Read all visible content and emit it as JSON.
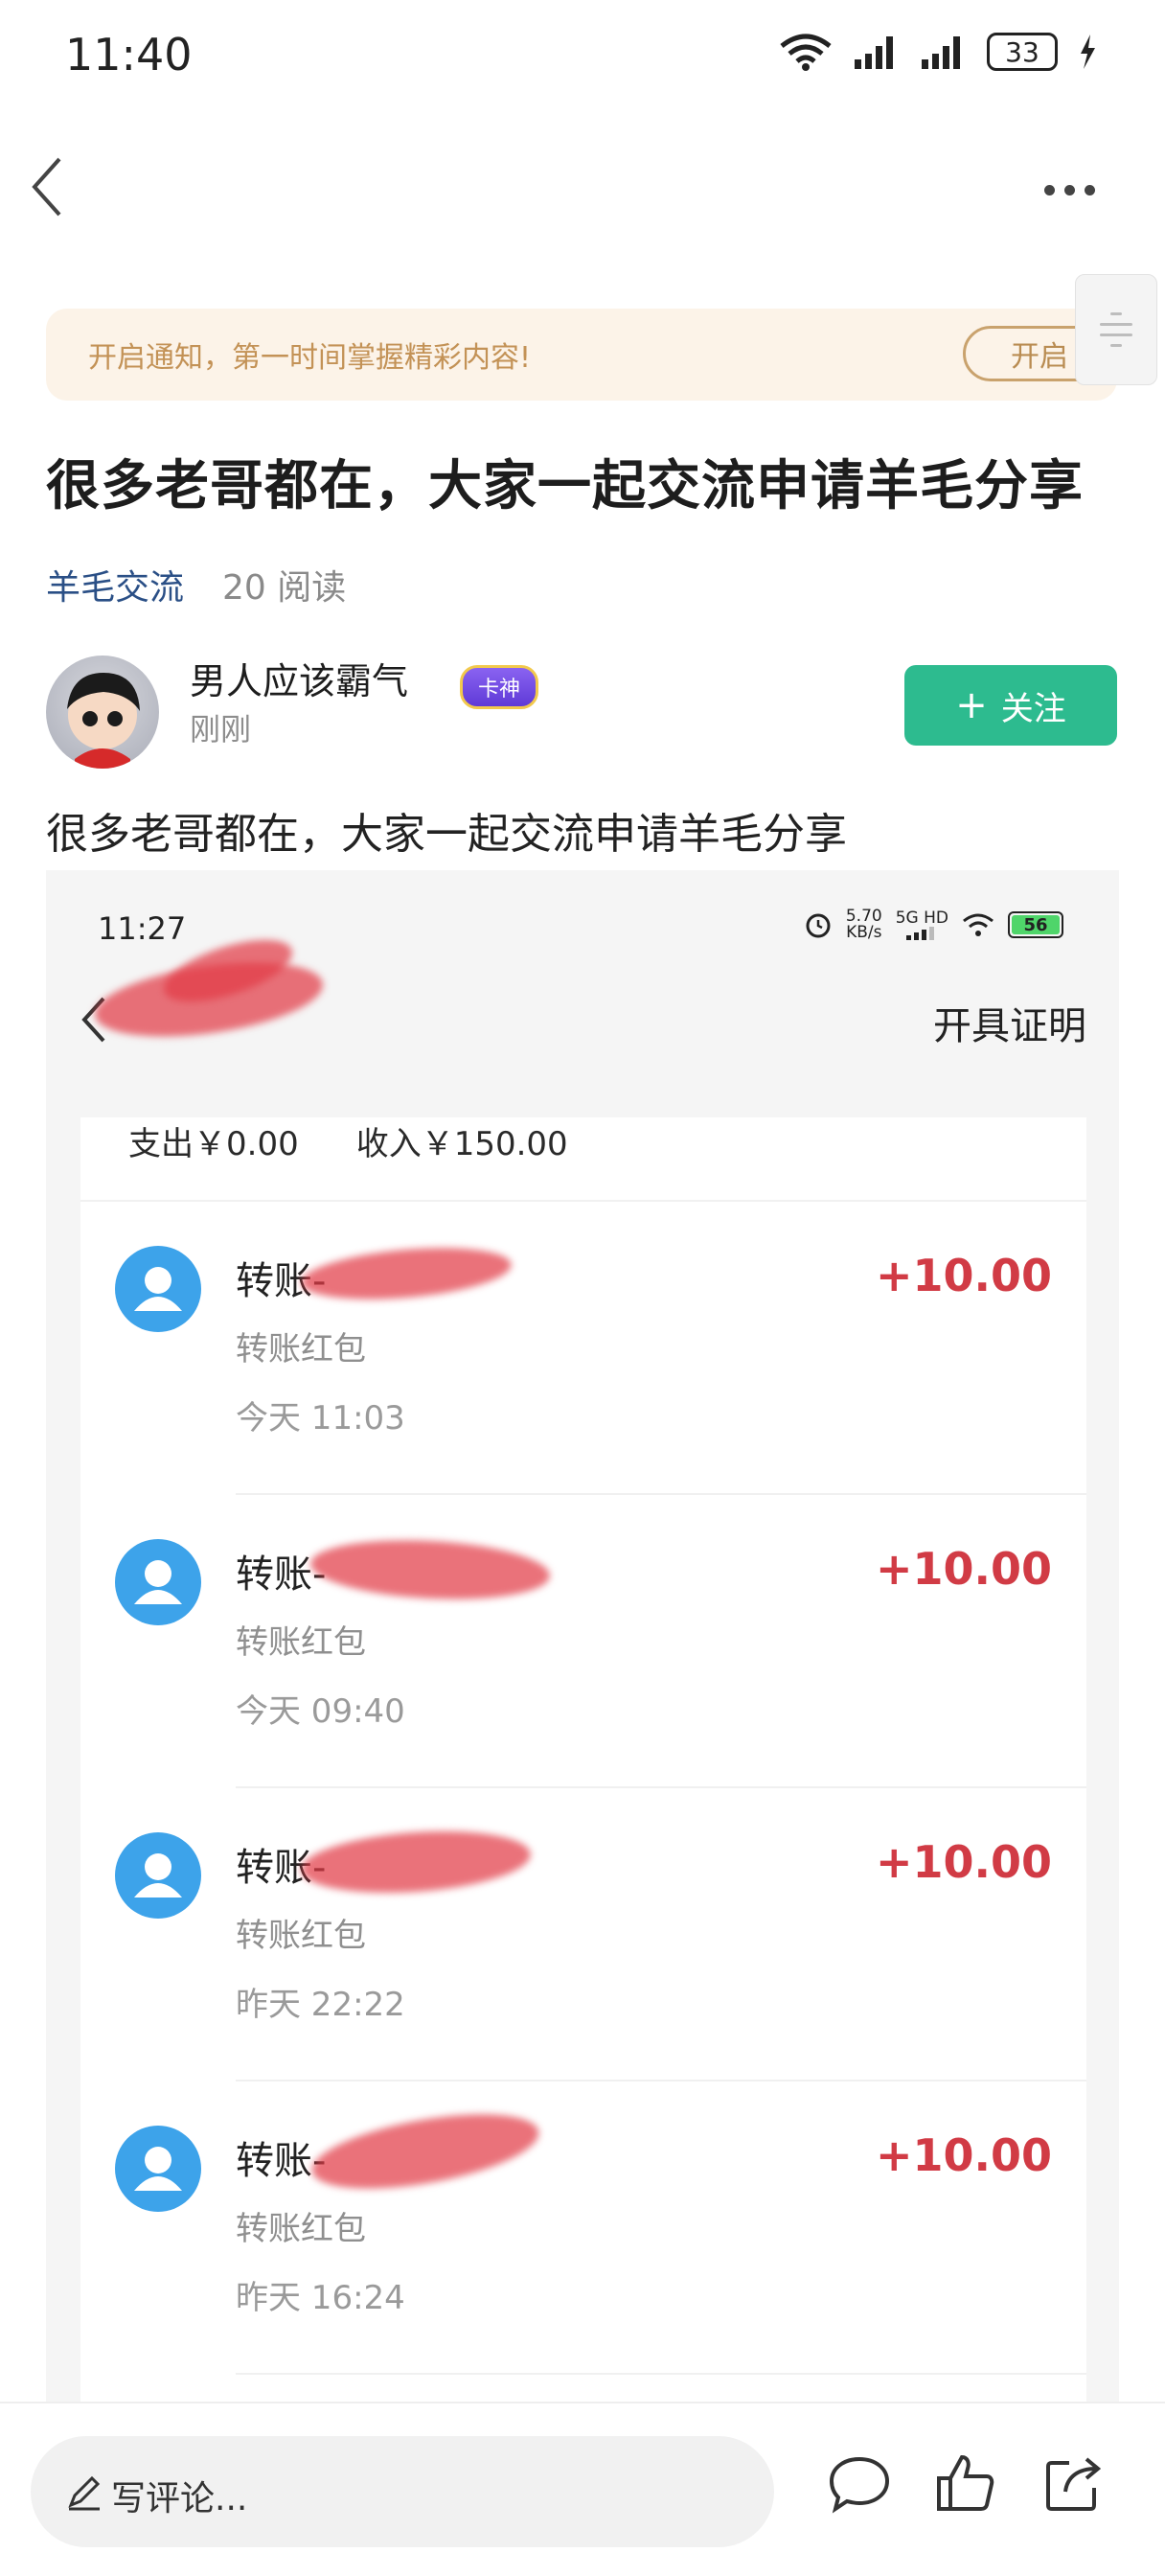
{
  "status_bar": {
    "time": "11:40",
    "battery": "33"
  },
  "notice": {
    "text": "开启通知，第一时间掌握精彩内容!",
    "button": "开启"
  },
  "post": {
    "title": "很多老哥都在，大家一起交流申请羊毛分享",
    "topic": "羊毛交流",
    "reads": "20 阅读",
    "author": {
      "name": "男人应该霸气",
      "badge": "卡神",
      "time": "刚刚"
    },
    "follow_label": "关注",
    "body": "很多老哥都在，大家一起交流申请羊毛分享"
  },
  "screenshot": {
    "time": "11:27",
    "net_speed": "5.70",
    "net_unit": "KB/s",
    "net_type": "5G HD",
    "battery": "56",
    "cert_label": "开具证明",
    "summary": {
      "expense": "支出￥0.00",
      "income": "收入￥150.00"
    },
    "transactions": [
      {
        "title": "转账-",
        "sub": "转账红包",
        "time": "今天 11:03",
        "amount": "+10.00"
      },
      {
        "title": "转账-",
        "sub": "转账红包",
        "time": "今天 09:40",
        "amount": "+10.00"
      },
      {
        "title": "转账-",
        "sub": "转账红包",
        "time": "昨天 22:22",
        "amount": "+10.00"
      },
      {
        "title": "转账-",
        "sub": "转账红包",
        "time": "昨天 16:24",
        "amount": "+10.00"
      }
    ]
  },
  "bottom": {
    "comment_placeholder": "写评论..."
  },
  "colors": {
    "follow": "#2dbb8f",
    "amount": "#d13b45",
    "topic": "#2a4f86",
    "notice_bg": "#fcf3e8"
  }
}
